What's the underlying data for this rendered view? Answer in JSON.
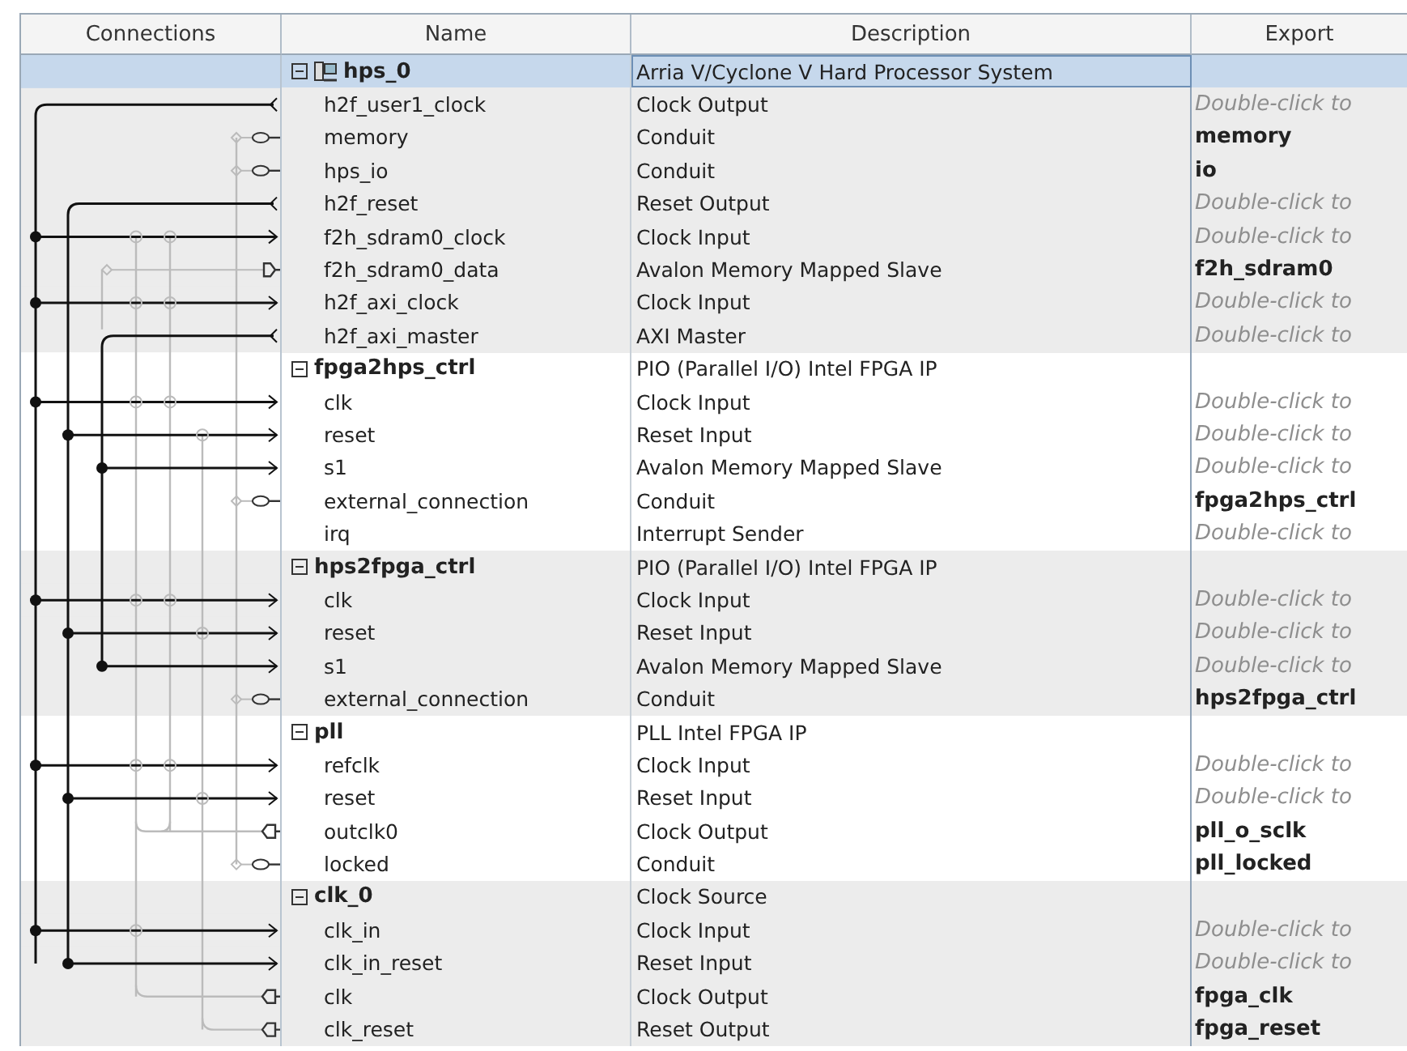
{
  "columns": [
    "Connections",
    "Name",
    "Description",
    "Export"
  ],
  "components": [
    {
      "name": "hps_0",
      "description": "Arria V/Cyclone V Hard Processor System",
      "selected": true,
      "icon": true,
      "ports": [
        {
          "name": "h2f_user1_clock",
          "description": "Clock Output",
          "export_placeholder": "Double-click to"
        },
        {
          "name": "memory",
          "description": "Conduit",
          "export": "memory"
        },
        {
          "name": "hps_io",
          "description": "Conduit",
          "export": "io"
        },
        {
          "name": "h2f_reset",
          "description": "Reset Output",
          "export_placeholder": "Double-click to"
        },
        {
          "name": "f2h_sdram0_clock",
          "description": "Clock Input",
          "export_placeholder": "Double-click to"
        },
        {
          "name": "f2h_sdram0_data",
          "description": "Avalon Memory Mapped Slave",
          "export": "f2h_sdram0"
        },
        {
          "name": "h2f_axi_clock",
          "description": "Clock Input",
          "export_placeholder": "Double-click to"
        },
        {
          "name": "h2f_axi_master",
          "description": "AXI Master",
          "export_placeholder": "Double-click to"
        }
      ]
    },
    {
      "name": "fpga2hps_ctrl",
      "description": "PIO (Parallel I/O) Intel FPGA IP",
      "selected": false,
      "icon": false,
      "ports": [
        {
          "name": "clk",
          "description": "Clock Input",
          "export_placeholder": "Double-click to"
        },
        {
          "name": "reset",
          "description": "Reset Input",
          "export_placeholder": "Double-click to"
        },
        {
          "name": "s1",
          "description": "Avalon Memory Mapped Slave",
          "export_placeholder": "Double-click to"
        },
        {
          "name": "external_connection",
          "description": "Conduit",
          "export": "fpga2hps_ctrl"
        },
        {
          "name": "irq",
          "description": "Interrupt Sender",
          "export_placeholder": "Double-click to"
        }
      ]
    },
    {
      "name": "hps2fpga_ctrl",
      "description": "PIO (Parallel I/O) Intel FPGA IP",
      "selected": false,
      "icon": false,
      "ports": [
        {
          "name": "clk",
          "description": "Clock Input",
          "export_placeholder": "Double-click to"
        },
        {
          "name": "reset",
          "description": "Reset Input",
          "export_placeholder": "Double-click to"
        },
        {
          "name": "s1",
          "description": "Avalon Memory Mapped Slave",
          "export_placeholder": "Double-click to"
        },
        {
          "name": "external_connection",
          "description": "Conduit",
          "export": "hps2fpga_ctrl"
        }
      ]
    },
    {
      "name": "pll",
      "description": "PLL Intel FPGA IP",
      "selected": false,
      "icon": false,
      "ports": [
        {
          "name": "refclk",
          "description": "Clock Input",
          "export_placeholder": "Double-click to"
        },
        {
          "name": "reset",
          "description": "Reset Input",
          "export_placeholder": "Double-click to"
        },
        {
          "name": "outclk0",
          "description": "Clock Output",
          "export": "pll_o_sclk"
        },
        {
          "name": "locked",
          "description": "Conduit",
          "export": "pll_locked"
        }
      ]
    },
    {
      "name": "clk_0",
      "description": "Clock Source",
      "selected": false,
      "icon": false,
      "ports": [
        {
          "name": "clk_in",
          "description": "Clock Input",
          "export_placeholder": "Double-click to"
        },
        {
          "name": "clk_in_reset",
          "description": "Reset Input",
          "export_placeholder": "Double-click to"
        },
        {
          "name": "clk",
          "description": "Clock Output",
          "export": "fpga_clk"
        },
        {
          "name": "clk_reset",
          "description": "Reset Output",
          "export": "fpga_reset"
        }
      ]
    }
  ]
}
